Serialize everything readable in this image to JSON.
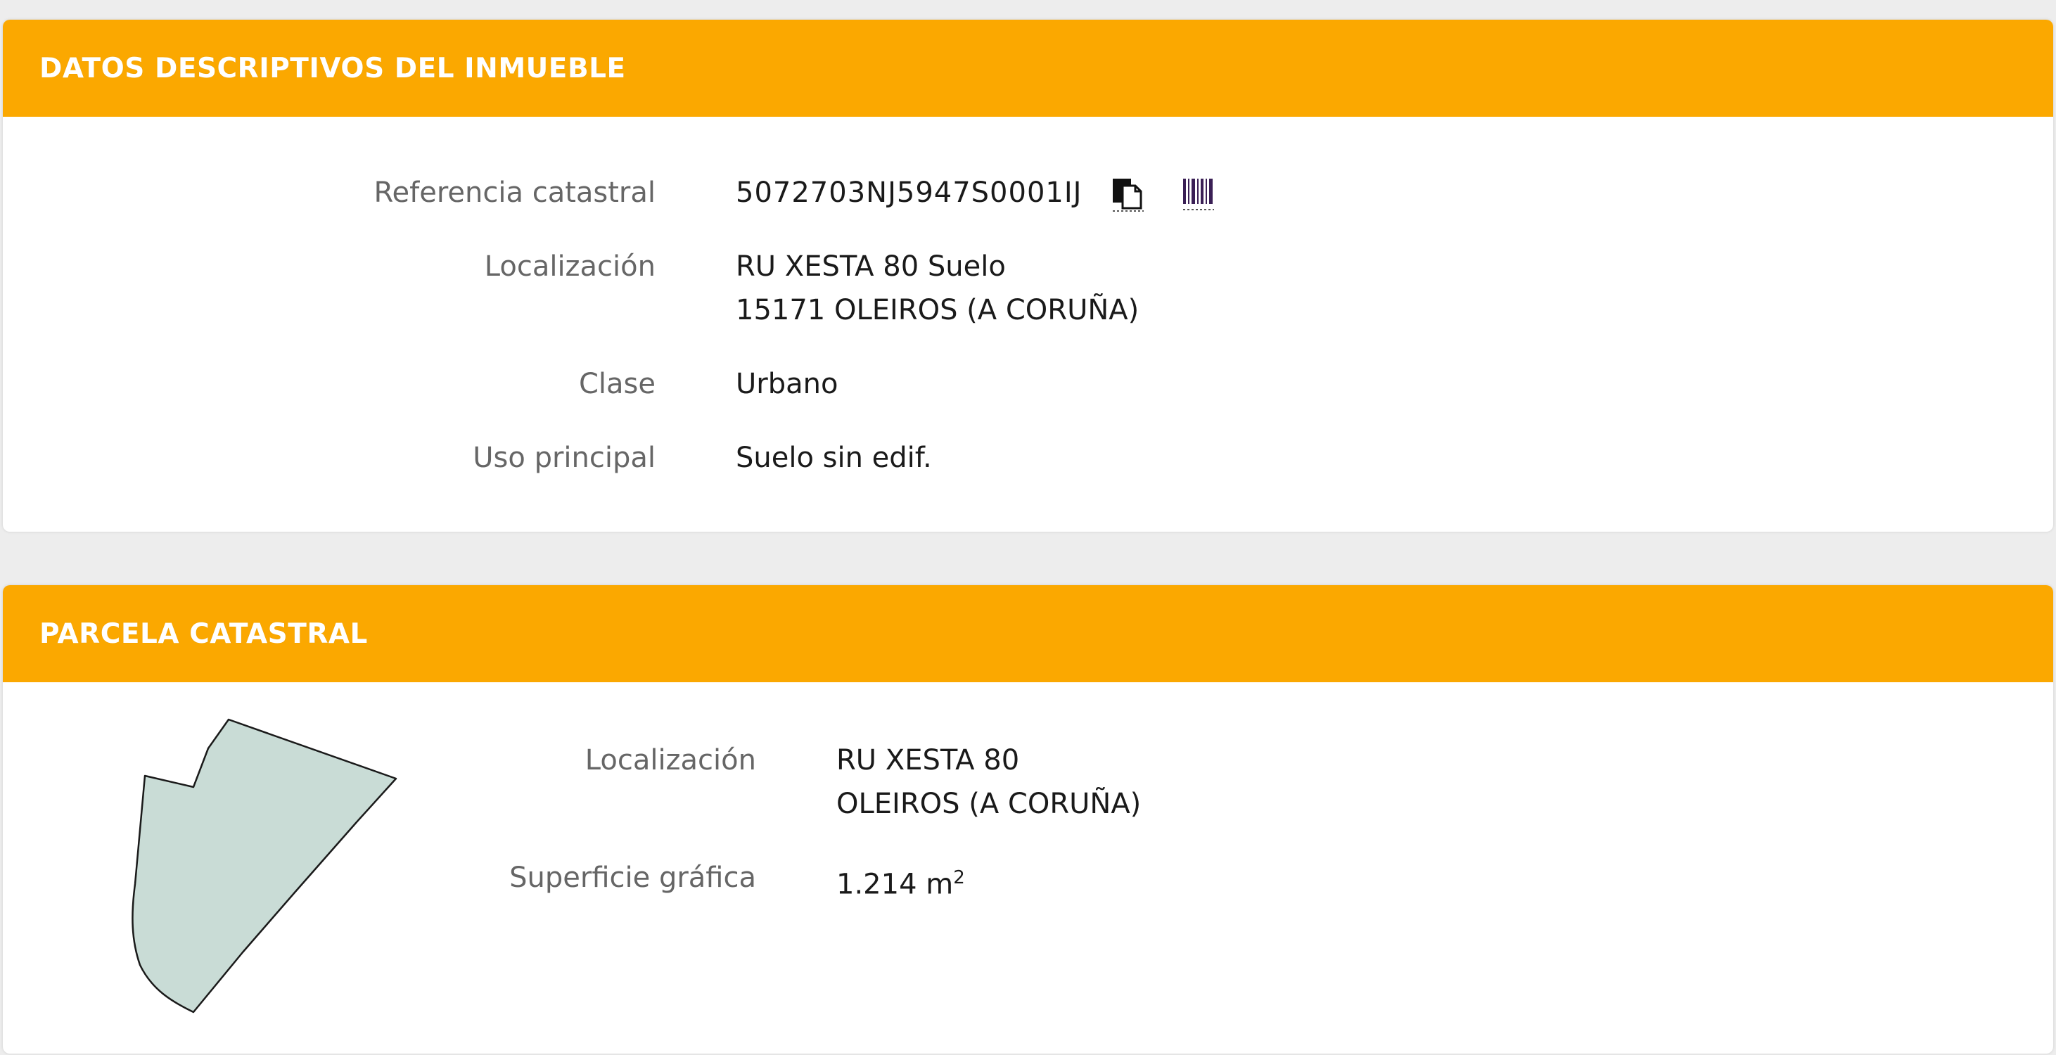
{
  "datos": {
    "title": "DATOS DESCRIPTIVOS DEL INMUEBLE",
    "rows": [
      {
        "label": "Referencia catastral",
        "value": "5072703NJ5947S0001IJ"
      },
      {
        "label": "Localización",
        "line1": "RU XESTA 80 Suelo",
        "line2": "15171 OLEIROS (A CORUÑA)"
      },
      {
        "label": "Clase",
        "value": "Urbano"
      },
      {
        "label": "Uso principal",
        "value": "Suelo sin edif."
      }
    ],
    "icons": [
      "copy-icon",
      "barcode-icon"
    ]
  },
  "parcela": {
    "title": "PARCELA CATASTRAL",
    "localizacion_label": "Localización",
    "localizacion_line1": "RU XESTA 80",
    "localizacion_line2": "OLEIROS (A CORUÑA)",
    "superficie_label": "Superficie gráfica",
    "superficie_value": "1.214 m",
    "superficie_exp": "2"
  },
  "colors": {
    "header": "#fba800",
    "parcel_fill": "#c9dcd6",
    "parcel_stroke": "#1a1a1a"
  }
}
